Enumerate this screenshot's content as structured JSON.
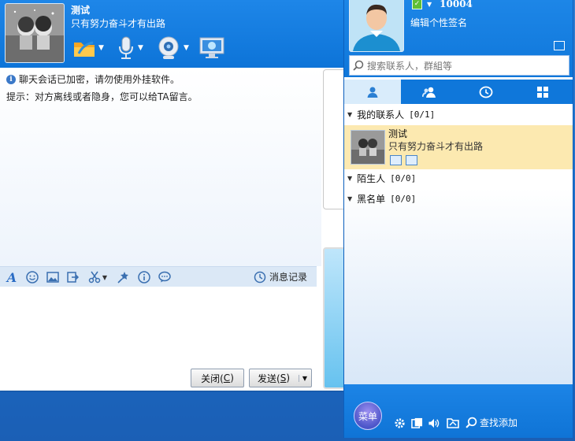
{
  "chat": {
    "contact_name": "测试",
    "contact_signature": "只有努力奋斗才有出路",
    "notice_encrypted": "聊天会话已加密，请勿使用外挂软件。",
    "notice_offline": "提示：对方离线或者隐身，您可以给TA留言。",
    "history_label": "消息记录",
    "close_label": "关闭(",
    "close_key": "C",
    "close_suffix": ")",
    "send_label": "发送(",
    "send_key": "S",
    "send_suffix": ")"
  },
  "me": {
    "id": "10004",
    "signature": "编辑个性签名"
  },
  "search": {
    "placeholder": "搜索联系人，群組等"
  },
  "groups": [
    {
      "name": "我的联系人",
      "count": "[0/1]"
    },
    {
      "name": "陌生人",
      "count": "[0/0]"
    },
    {
      "name": "黑名单",
      "count": "[0/0]"
    }
  ],
  "contact": {
    "name": "测试",
    "signature": "只有努力奋斗才有出路"
  },
  "footer": {
    "menu_label": "菜单",
    "find_label": "查找添加"
  },
  "colors": {
    "accent": "#0f77da",
    "contact_highlight": "#fce9b0",
    "toolbar_bg": "#dbe8f6"
  }
}
